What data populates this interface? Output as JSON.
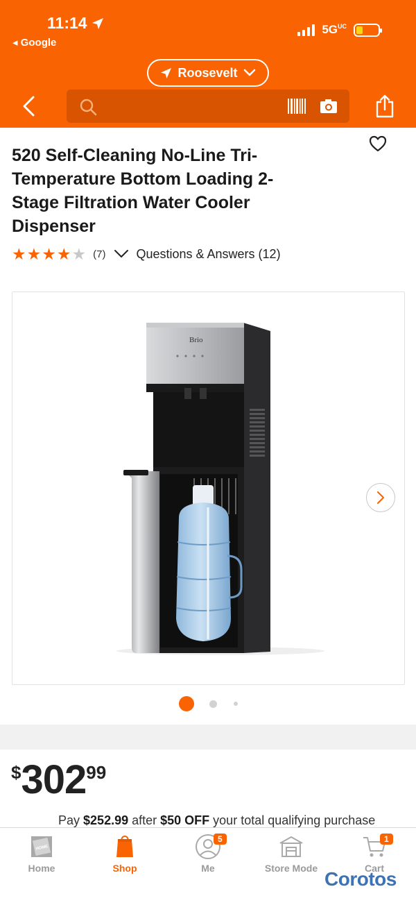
{
  "status_bar": {
    "time": "11:14",
    "back_app": "◂ Google",
    "network": "5G",
    "network_suffix": "UC"
  },
  "header": {
    "store_name": "Roosevelt",
    "search_placeholder": ""
  },
  "product": {
    "title": "520 Self-Cleaning No-Line Tri-Temperature Bottom Loading 2-Stage Filtration Water Cooler Dispenser",
    "rating_stars": 4,
    "rating_max": 5,
    "review_count": "(7)",
    "qa_link": "Questions & Answers (12)",
    "brand_on_image": "Brio",
    "image_count": 3,
    "active_image": 1
  },
  "price": {
    "currency_symbol": "$",
    "dollars": "302",
    "cents": "99"
  },
  "promo": {
    "prefix": "Pay ",
    "amount": "$252.99",
    "middle": " after ",
    "discount": "$50 OFF",
    "suffix": " your total qualifying purchase"
  },
  "bottom_nav": {
    "items": [
      {
        "label": "Home",
        "icon": "home-depot-logo-icon",
        "badge": ""
      },
      {
        "label": "Shop",
        "icon": "shop-bag-icon",
        "badge": ""
      },
      {
        "label": "Me",
        "icon": "person-icon",
        "badge": "5"
      },
      {
        "label": "Store Mode",
        "icon": "store-icon",
        "badge": ""
      },
      {
        "label": "Cart",
        "icon": "cart-icon",
        "badge": "1"
      }
    ],
    "active": "Shop"
  },
  "watermark": "Corotos",
  "colors": {
    "brand_orange": "#f96302",
    "search_bg": "#d85400",
    "star_filled": "#f96302",
    "star_empty": "#c8c8c8",
    "watermark_blue": "#3d73b4"
  }
}
